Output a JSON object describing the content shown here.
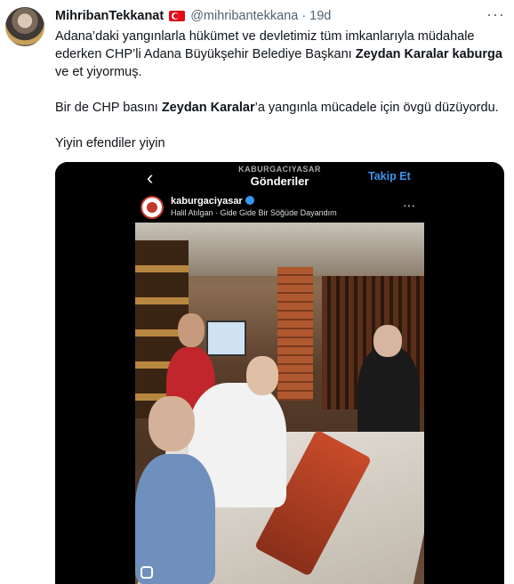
{
  "tweet": {
    "display_name": "MihribanTekkanat",
    "flag_icon": "turkey-flag-icon",
    "handle": "@mihribantekkana",
    "separator": "·",
    "time": "19d",
    "more": "···",
    "text": {
      "p1_part1": "Adana’daki yangınlarla hükümet ve devletimiz tüm imkanlarıyla müdahale ederken CHP’li Adana Büyükşehir Belediye Başkanı ",
      "p1_bold": "Zeydan Karalar kaburga",
      "p1_part2": " ve et yiyormuş.",
      "p2_part1": "Bir de CHP basını ",
      "p2_bold": "Zeydan Karalar",
      "p2_part2": "’a yangınla mücadele için övgü düzüyordu.",
      "p3": "Yiyin efendiler yiyin"
    }
  },
  "media": {
    "ig": {
      "account_top": "KABURGACIYASAR",
      "title": "Gönderiler",
      "back": "‹",
      "follow": "Takip Et",
      "username": "kaburgaciyasar",
      "music": "Halil Atılgan · Gide Gide Bir Söğüde Dayandım",
      "more": "···"
    }
  }
}
